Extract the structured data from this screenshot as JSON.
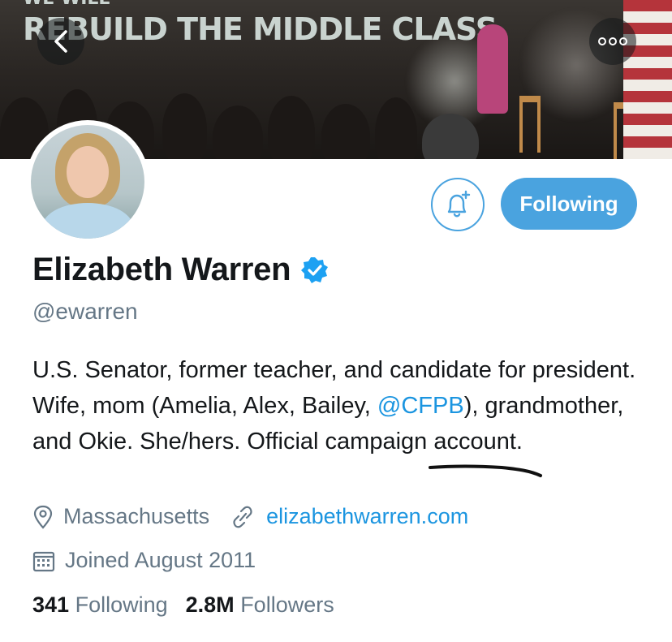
{
  "banner": {
    "top_text": "WE WILL",
    "title": "REBUILD THE MIDDLE CLASS"
  },
  "nav": {
    "back_icon": "chevron-left-icon",
    "more_icon": "more-options-icon"
  },
  "profile": {
    "name": "Elizabeth Warren",
    "verified_icon": "verified-badge-icon",
    "handle": "@ewarren",
    "bio_before_mention": "U.S. Senator, former teacher, and candidate for president. Wife, mom (Amelia, Alex, Bailey, ",
    "bio_mention": "@CFPB",
    "bio_after_mention": "), grandmother, and Okie. She/hers. Official campaign account.",
    "location": "Massachusetts",
    "website": "elizabethwarren.com",
    "joined": "Joined August 2011"
  },
  "actions": {
    "notify_icon": "bell-plus-icon",
    "follow_label": "Following"
  },
  "stats": {
    "following_count": "341",
    "following_label": "Following",
    "followers_count": "2.8M",
    "followers_label": "Followers"
  },
  "colors": {
    "accent": "#4aa3df",
    "link": "#1b95e0",
    "muted": "#657786",
    "text": "#14171a"
  }
}
